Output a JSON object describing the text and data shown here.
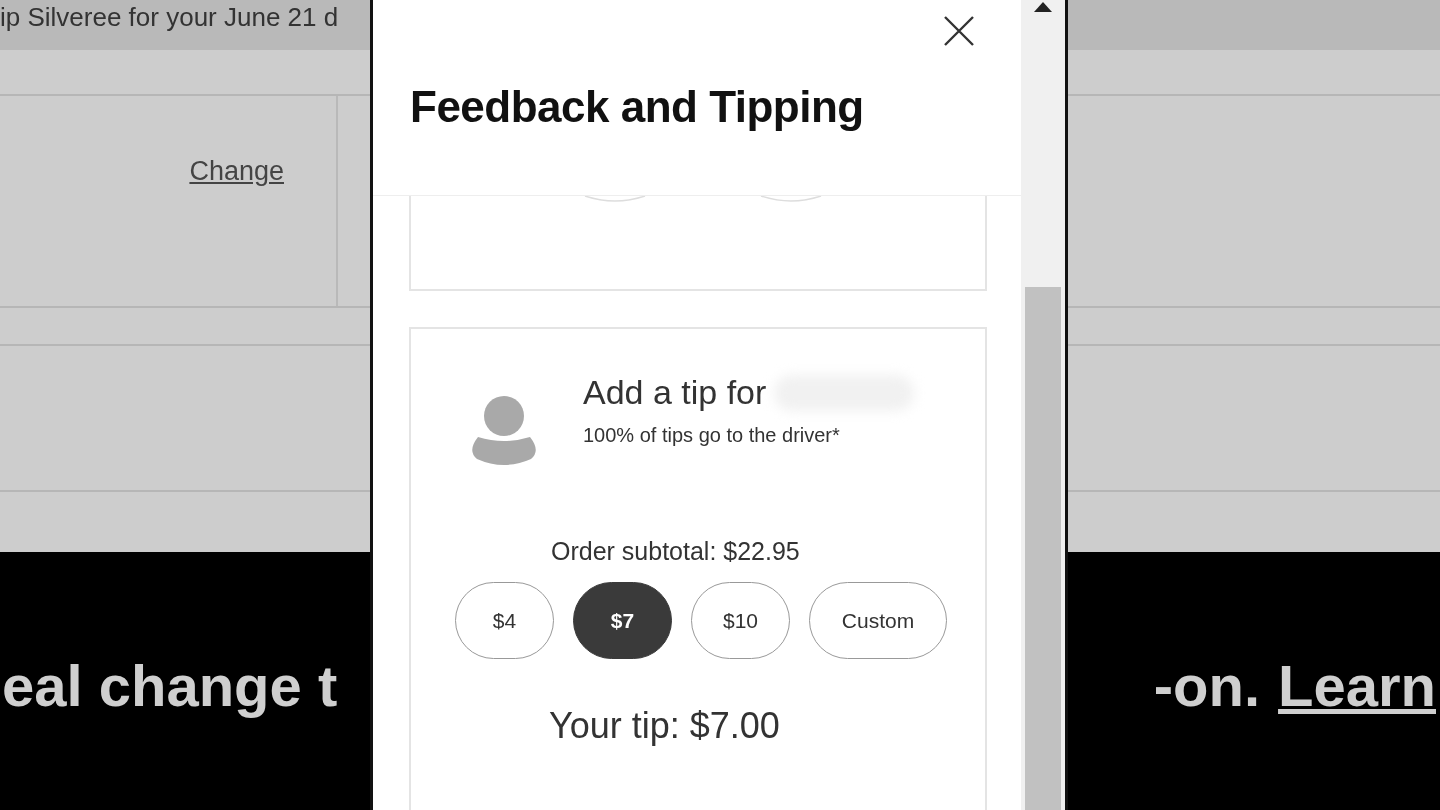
{
  "background": {
    "banner_text": "ip Silveree for your June 21 d",
    "link": "Change",
    "promo_left": "eal change t",
    "promo_right": "-on.",
    "promo_link": "Learn"
  },
  "dialog": {
    "title": "Feedback and Tipping",
    "tip_card": {
      "heading": "Add a tip for",
      "note": "100% of tips go to the driver*",
      "subtotal": "Order subtotal: $22.95",
      "options": [
        {
          "label": "$4",
          "selected": false
        },
        {
          "label": "$7",
          "selected": true
        },
        {
          "label": "$10",
          "selected": false
        },
        {
          "label": "Custom",
          "selected": false
        }
      ],
      "your_tip": "Your tip: $7.00"
    }
  }
}
